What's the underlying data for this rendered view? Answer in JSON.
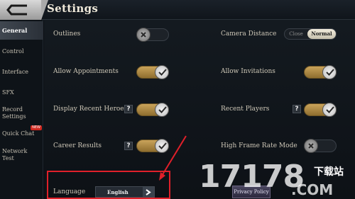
{
  "header": {
    "title": "Settings",
    "back_icon": "back-arrow-icon"
  },
  "sidebar": {
    "items": [
      {
        "label": "General",
        "active": true
      },
      {
        "label": "Control"
      },
      {
        "label": "Interface"
      },
      {
        "label": "SFX"
      },
      {
        "label": "Record Settings"
      },
      {
        "label": "Quick Chat",
        "badge": "NEW"
      },
      {
        "label": "Network Test"
      }
    ]
  },
  "settings": {
    "outlines": {
      "label": "Outlines",
      "on": false
    },
    "camera_distance": {
      "label": "Camera Distance",
      "options": [
        "Close",
        "Normal"
      ],
      "selected": "Normal"
    },
    "allow_appointments": {
      "label": "Allow Appointments",
      "on": true
    },
    "allow_invitations": {
      "label": "Allow Invitations",
      "on": true
    },
    "display_recent_heroes": {
      "label": "Display Recent Heroes",
      "help": "?",
      "on": true
    },
    "recent_players": {
      "label": "Recent Players",
      "help": "?",
      "on": true
    },
    "career_results": {
      "label": "Career Results",
      "help": "?",
      "on": true
    },
    "high_frame_rate": {
      "label": "High Frame Rate Mode",
      "on": false
    },
    "language": {
      "label": "Language",
      "value": "English"
    }
  },
  "privacy_button": {
    "label": "Privacy Policy"
  },
  "watermark": {
    "main": "17178",
    "sub1": "下载站",
    "sub2": ".COM"
  },
  "colors": {
    "toggle_on": "#c9a35a",
    "highlight": "#e0202a",
    "badge": "#d0281f"
  }
}
